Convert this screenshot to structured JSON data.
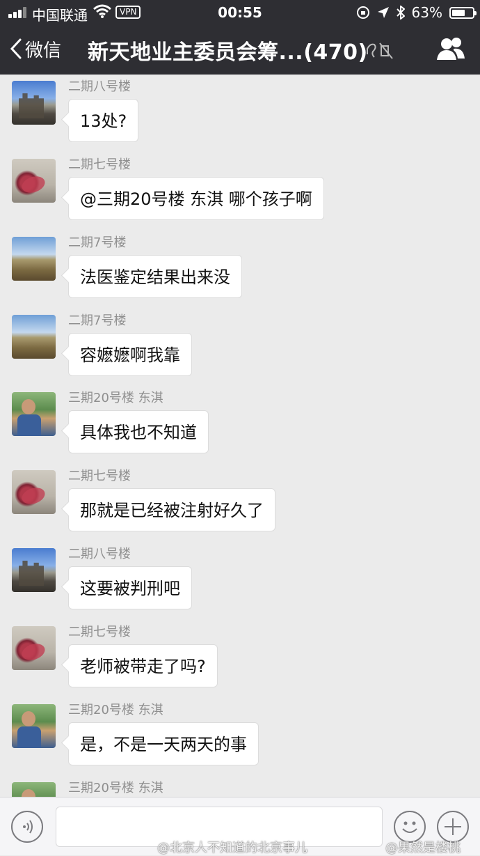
{
  "status_bar": {
    "carrier": "中国联通",
    "vpn": "VPN",
    "time": "00:55",
    "battery_text": "63%",
    "battery_level": 0.63
  },
  "nav": {
    "back_label": "微信",
    "title": "新天地业主委员会筹...(470)"
  },
  "messages": [
    {
      "sender": "二期八号楼",
      "text": "13处?",
      "avatar": "castle-photo"
    },
    {
      "sender": "二期七号楼",
      "text": "@三期20号楼 东淇 哪个孩子啊",
      "avatar": "flower-photo"
    },
    {
      "sender": "二期7号楼",
      "text": "法医鉴定结果出来没",
      "avatar": "field-photo"
    },
    {
      "sender": "二期7号楼",
      "text": "容嬷嬷啊我靠",
      "avatar": "field-photo"
    },
    {
      "sender": "三期20号楼 东淇",
      "text": "具体我也不知道",
      "avatar": "family-photo"
    },
    {
      "sender": "二期七号楼",
      "text": "那就是已经被注射好久了",
      "avatar": "flower-photo"
    },
    {
      "sender": "二期八号楼",
      "text": "这要被判刑吧",
      "avatar": "castle-photo"
    },
    {
      "sender": "二期七号楼",
      "text": "老师被带走了吗?",
      "avatar": "flower-photo"
    },
    {
      "sender": "三期20号楼 东淇",
      "text": "是，不是一天两天的事",
      "avatar": "family-photo"
    },
    {
      "sender": "三期20号楼 东淇",
      "text": "",
      "avatar": "family-photo"
    }
  ],
  "input_bar": {
    "watermark_left": "@北京人不知道的北京事儿",
    "watermark_right": "@果然是楼桃"
  },
  "colors": {
    "nav_bg": "#2e2e33",
    "chat_bg": "#ebebeb",
    "bubble_bg": "#ffffff",
    "sender_text": "#8f8f8f"
  }
}
